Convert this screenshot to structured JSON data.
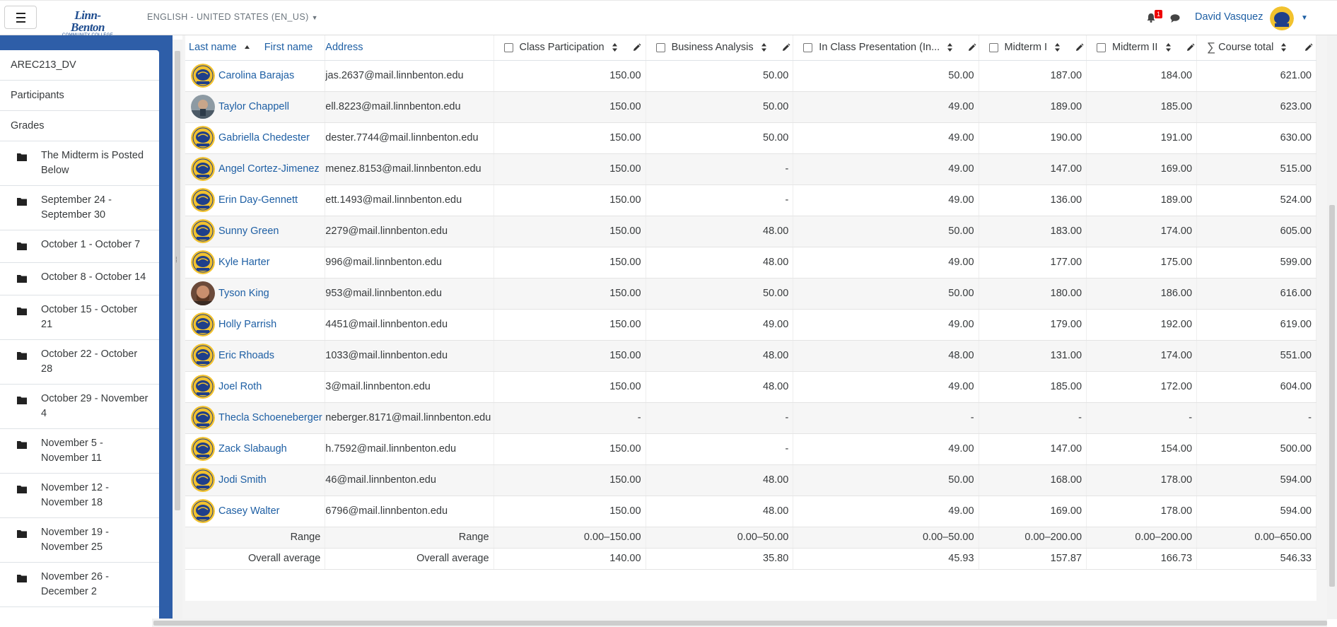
{
  "header": {
    "logo_line1": "Linn-Benton",
    "logo_line2": "COMMUNITY COLLEGE",
    "language": "ENGLISH - UNITED STATES (EN_US)",
    "notification_count": "1",
    "user_name": "David Vasquez"
  },
  "sidebar": {
    "items": [
      {
        "label": "AREC213_DV"
      },
      {
        "label": "Participants"
      },
      {
        "label": "Grades"
      }
    ],
    "sections": [
      {
        "label": "The Midterm is Posted Below"
      },
      {
        "label": "September 24 - September 30"
      },
      {
        "label": "October 1 - October 7"
      },
      {
        "label": "October 8 - October 14"
      },
      {
        "label": "October 15 - October 21"
      },
      {
        "label": "October 22 - October 28"
      },
      {
        "label": "October 29 - November 4"
      },
      {
        "label": "November 5 - November 11"
      },
      {
        "label": "November 12 - November 18"
      },
      {
        "label": "November 19 - November 25"
      },
      {
        "label": "November 26 - December 2"
      }
    ]
  },
  "table": {
    "headers": {
      "last_name": "Last name",
      "first_name": "First name",
      "address": "Address",
      "col1": "Class Participation",
      "col2": "Business Analysis",
      "col3": "In Class Presentation (In...",
      "col4": "Midterm I",
      "col5": "Midterm II",
      "col6": "Course total"
    },
    "rows": [
      {
        "name": "Carolina Barajas",
        "email": "jas.2637@mail.linnbenton.edu",
        "v": [
          "150.00",
          "50.00",
          "50.00",
          "187.00",
          "184.00",
          "621.00"
        ]
      },
      {
        "name": "Taylor Chappell",
        "email": "ell.8223@mail.linnbenton.edu",
        "v": [
          "150.00",
          "50.00",
          "49.00",
          "189.00",
          "185.00",
          "623.00"
        ]
      },
      {
        "name": "Gabriella Chedester",
        "email": "dester.7744@mail.linnbenton.edu",
        "v": [
          "150.00",
          "50.00",
          "49.00",
          "190.00",
          "191.00",
          "630.00"
        ]
      },
      {
        "name": "Angel Cortez-Jimenez",
        "email": "menez.8153@mail.linnbenton.edu",
        "v": [
          "150.00",
          "-",
          "49.00",
          "147.00",
          "169.00",
          "515.00"
        ]
      },
      {
        "name": "Erin Day-Gennett",
        "email": "ett.1493@mail.linnbenton.edu",
        "v": [
          "150.00",
          "-",
          "49.00",
          "136.00",
          "189.00",
          "524.00"
        ]
      },
      {
        "name": "Sunny Green",
        "email": "2279@mail.linnbenton.edu",
        "v": [
          "150.00",
          "48.00",
          "50.00",
          "183.00",
          "174.00",
          "605.00"
        ]
      },
      {
        "name": "Kyle Harter",
        "email": "996@mail.linnbenton.edu",
        "v": [
          "150.00",
          "48.00",
          "49.00",
          "177.00",
          "175.00",
          "599.00"
        ]
      },
      {
        "name": "Tyson King",
        "email": "953@mail.linnbenton.edu",
        "v": [
          "150.00",
          "50.00",
          "50.00",
          "180.00",
          "186.00",
          "616.00"
        ]
      },
      {
        "name": "Holly Parrish",
        "email": "4451@mail.linnbenton.edu",
        "v": [
          "150.00",
          "49.00",
          "49.00",
          "179.00",
          "192.00",
          "619.00"
        ]
      },
      {
        "name": "Eric Rhoads",
        "email": "1033@mail.linnbenton.edu",
        "v": [
          "150.00",
          "48.00",
          "48.00",
          "131.00",
          "174.00",
          "551.00"
        ]
      },
      {
        "name": "Joel Roth",
        "email": "3@mail.linnbenton.edu",
        "v": [
          "150.00",
          "48.00",
          "49.00",
          "185.00",
          "172.00",
          "604.00"
        ]
      },
      {
        "name": "Thecla Schoeneberger",
        "email": "neberger.8171@mail.linnbenton.edu",
        "v": [
          "-",
          "-",
          "-",
          "-",
          "-",
          "-"
        ]
      },
      {
        "name": "Zack Slabaugh",
        "email": "h.7592@mail.linnbenton.edu",
        "v": [
          "150.00",
          "-",
          "49.00",
          "147.00",
          "154.00",
          "500.00"
        ]
      },
      {
        "name": "Jodi Smith",
        "email": "46@mail.linnbenton.edu",
        "v": [
          "150.00",
          "48.00",
          "50.00",
          "168.00",
          "178.00",
          "594.00"
        ]
      },
      {
        "name": "Casey Walter",
        "email": "6796@mail.linnbenton.edu",
        "v": [
          "150.00",
          "48.00",
          "49.00",
          "169.00",
          "178.00",
          "594.00"
        ]
      }
    ],
    "range": {
      "label": "Range",
      "v": [
        "0.00–150.00",
        "0.00–50.00",
        "0.00–50.00",
        "0.00–200.00",
        "0.00–200.00",
        "0.00–650.00"
      ]
    },
    "average": {
      "label": "Overall average",
      "v": [
        "140.00",
        "35.80",
        "45.93",
        "157.87",
        "166.73",
        "546.33"
      ]
    }
  },
  "colors": {
    "link": "#1e5fa4",
    "drawer": "#2e5ea8",
    "badge": "#e00000"
  }
}
